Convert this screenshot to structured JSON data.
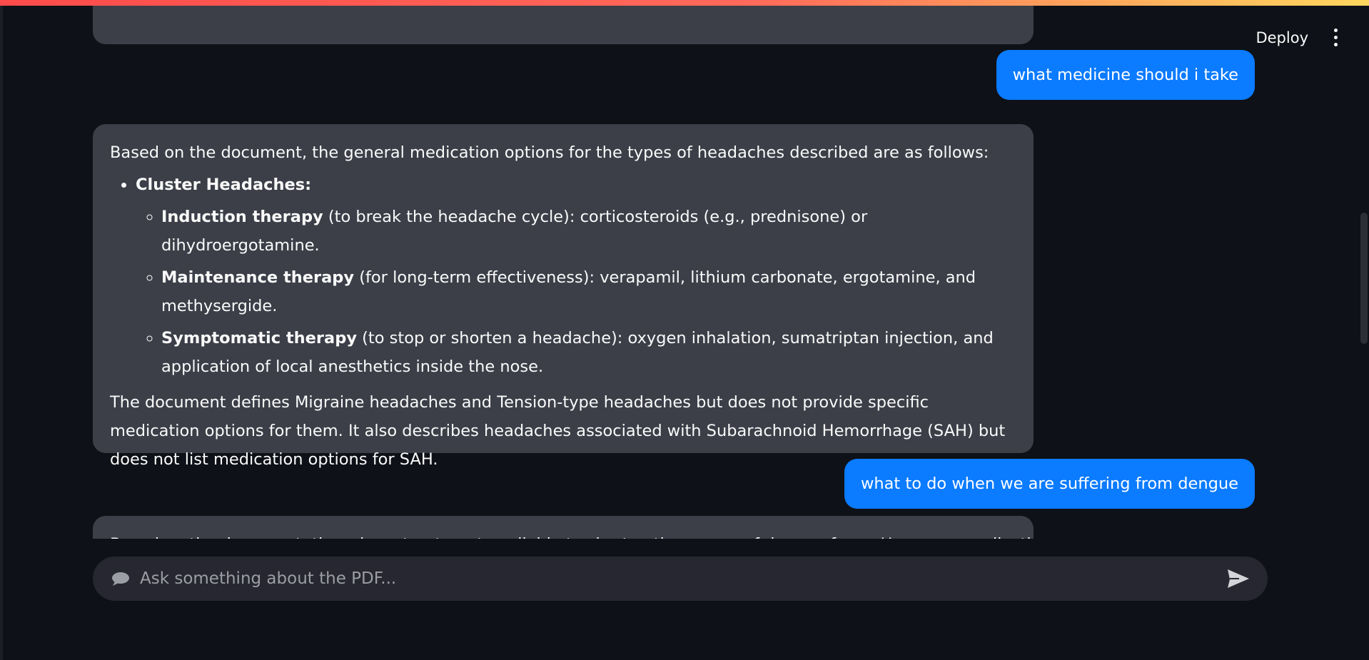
{
  "toolbar": {
    "deploy_label": "Deploy",
    "menu_icon": "vertical-dots-icon"
  },
  "messages": {
    "user_1": "what medicine should i take",
    "assistant_1": {
      "intro": "Based on the document, the general medication options for the types of headaches described are as follows:",
      "bullet_heading": "Cluster Headaches:",
      "items": [
        {
          "bold": "Induction therapy",
          "text": " (to break the headache cycle): corticosteroids (e.g., prednisone) or dihydroergotamine."
        },
        {
          "bold": "Maintenance therapy",
          "text": " (for long-term effectiveness): verapamil, lithium carbonate, ergotamine, and methysergide."
        },
        {
          "bold": "Symptomatic therapy",
          "text": " (to stop or shorten a headache): oxygen inhalation, sumatriptan injection, and application of local anesthetics inside the nose."
        }
      ],
      "closing": "The document defines Migraine headaches and Tension-type headaches but does not provide specific medication options for them. It also describes headaches associated with Subarachnoid Hemorrhage (SAH) but does not list medication options for SAH."
    },
    "user_2": "what to do when we are suffering from dengue",
    "assistant_2_partial": "Based on the document, there is no treatment available to shorten the course of dengue fever. However, medications can"
  },
  "chat_input": {
    "placeholder": "Ask something about the PDF...",
    "icon": "speech-bubble-icon",
    "send_icon": "send-arrow-icon"
  },
  "colors": {
    "user_bubble": "#0b7bff",
    "assistant_bubble": "#3c3f48",
    "background": "#0e1117",
    "input_bg": "#262730"
  }
}
